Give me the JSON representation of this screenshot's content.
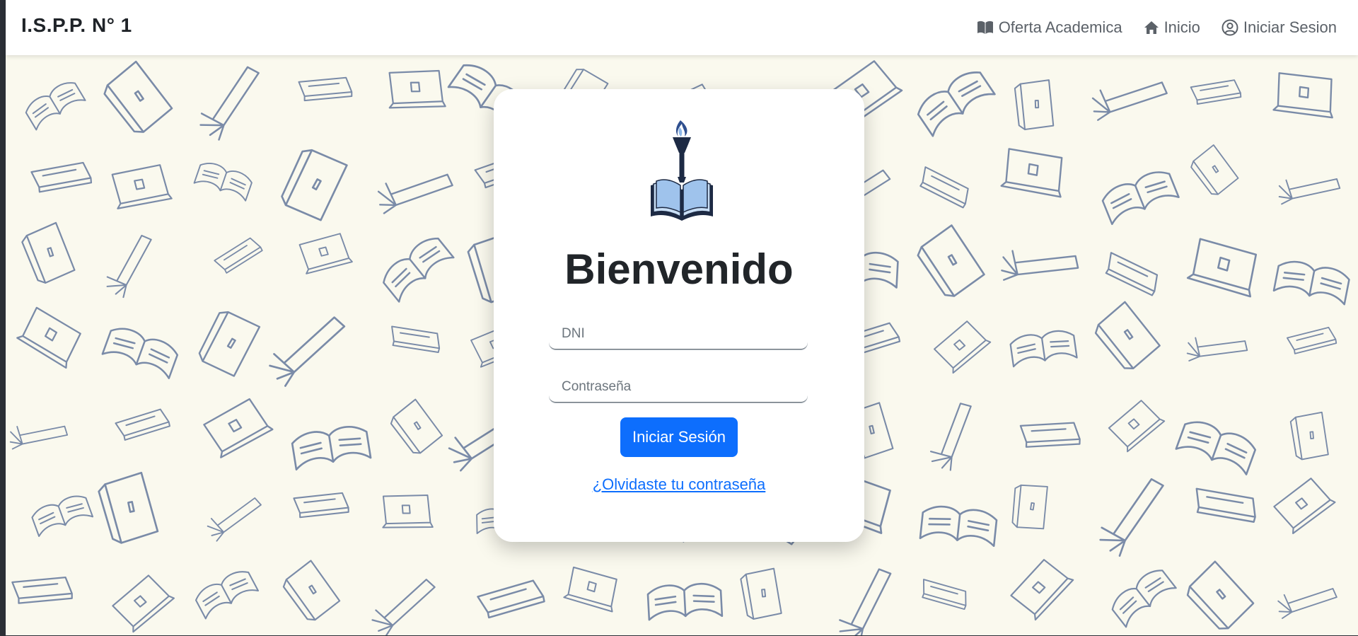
{
  "navbar": {
    "brand": "I.S.P.P. N° 1",
    "links": [
      {
        "label": "Oferta Academica",
        "icon": "book-icon"
      },
      {
        "label": "Inicio",
        "icon": "home-icon"
      },
      {
        "label": "Iniciar Sesion",
        "icon": "user-circle-icon"
      }
    ]
  },
  "login_card": {
    "logo_icon": "torch-book-logo",
    "title": "Bienvenido",
    "dni_placeholder": "DNI",
    "password_placeholder": "Contraseña",
    "submit_label": "Iniciar Sesión",
    "forgot_label": "¿Olvidaste tu contraseña"
  },
  "colors": {
    "primary": "#0d6efd",
    "background": "#faf9ee",
    "pattern_stroke": "#7a8ba8",
    "text_dark": "#212529",
    "nav_text": "#5b6168"
  }
}
